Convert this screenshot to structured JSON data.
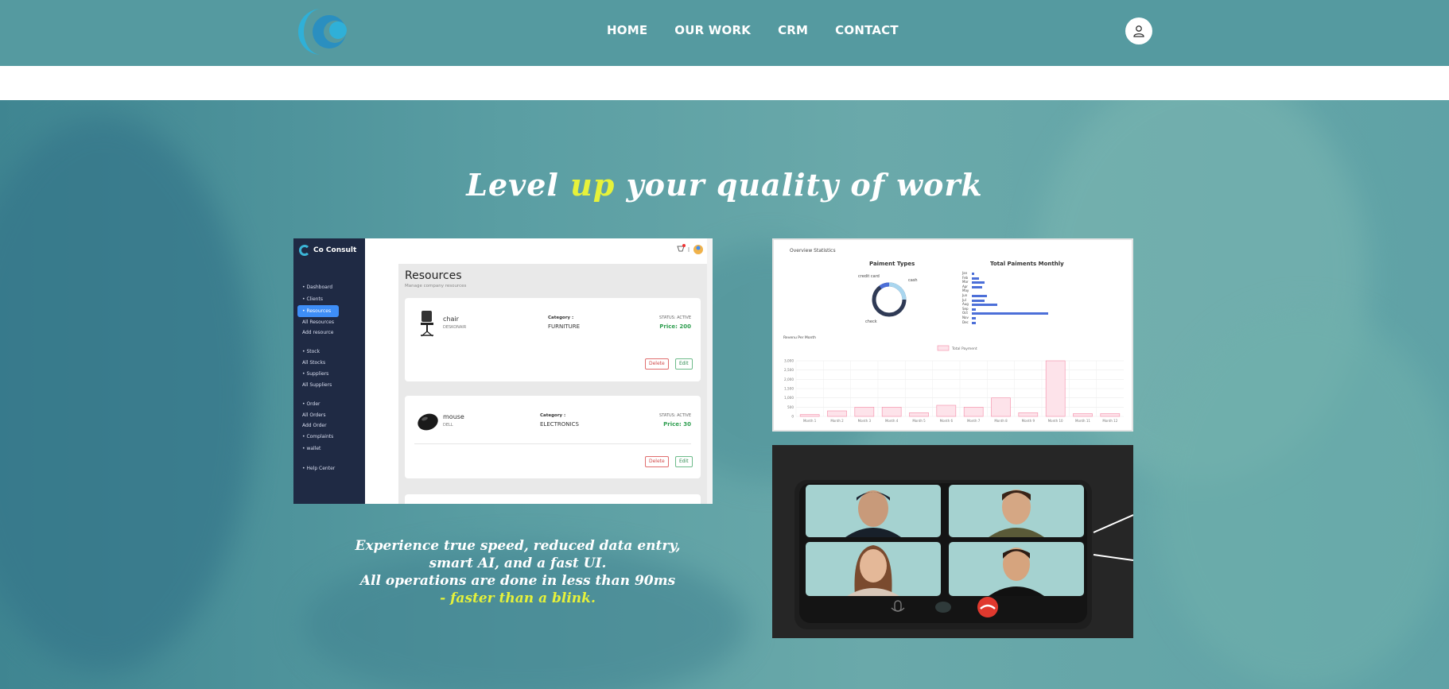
{
  "colors": {
    "navbar": "#559aa0",
    "accent_yellow": "#e6f23a",
    "brand_blue": "#3bb4d6"
  },
  "nav": {
    "logo_icon": "company-logo",
    "links": [
      "HOME",
      "OUR WORK",
      "CRM",
      "CONTACT"
    ],
    "user_icon": "user-icon"
  },
  "hero": {
    "headline_pre": "Level ",
    "headline_highlight": "up",
    "headline_post": " your quality of work",
    "caption_lines": [
      "Experience true speed, reduced data entry,",
      "smart AI, and a fast UI.",
      "All operations are done in less than 90ms"
    ],
    "caption_highlight": "- faster than a blink."
  },
  "resources_preview": {
    "brand": "Co Consult",
    "menu": [
      {
        "label": "Dashboard",
        "type": "main"
      },
      {
        "label": "Clients",
        "type": "main"
      },
      {
        "label": "Resources",
        "type": "active"
      },
      {
        "label": "All Resources",
        "type": "sub"
      },
      {
        "label": "Add resource",
        "type": "sub"
      },
      {
        "label": "Stock",
        "type": "main",
        "gap": true
      },
      {
        "label": "All Stocks",
        "type": "sub"
      },
      {
        "label": "Suppliers",
        "type": "main"
      },
      {
        "label": "All Suppliers",
        "type": "sub"
      },
      {
        "label": "Order",
        "type": "main",
        "gap": true
      },
      {
        "label": "All Orders",
        "type": "sub"
      },
      {
        "label": "Add Order",
        "type": "sub"
      },
      {
        "label": "Complaints",
        "type": "main"
      },
      {
        "label": "wallet",
        "type": "main"
      },
      {
        "label": "Help Center",
        "type": "main",
        "gap": true
      }
    ],
    "title": "Resources",
    "subtitle": "Manage company resources",
    "items": [
      {
        "name": "chair",
        "brand": "DESKONAIR",
        "category_label": "Category :",
        "category": "FURNITURE",
        "status": "STATUS: ACTIVE",
        "price": "Price: 200",
        "icon": "chair-icon"
      },
      {
        "name": "mouse",
        "brand": "DELL",
        "category_label": "Category :",
        "category": "ELECTRONICS",
        "status": "STATUS: ACTIVE",
        "price": "Price: 30",
        "icon": "mouse-icon"
      }
    ],
    "delete_label": "Delete",
    "edit_label": "Edit"
  },
  "stats_preview": {
    "header": "Overview Statistics",
    "donut_title": "Paiment Types",
    "donut_labels": [
      "credit card",
      "cash",
      "check"
    ],
    "bar_title": "Total Paiments Monthly",
    "month_labels": [
      "Jan",
      "Feb",
      "Mar",
      "Apr",
      "May",
      "Jun",
      "Jul",
      "Aug",
      "Sep",
      "Oct",
      "Nov",
      "Dec"
    ],
    "monthly_values": [
      3,
      8,
      15,
      12,
      0,
      18,
      15,
      30,
      5,
      90,
      5,
      5
    ],
    "revenue_title": "Revenu Per Month",
    "revenue_legend": "Total Payment",
    "revenue_yticks": [
      "3,000",
      "2,500",
      "2,000",
      "1,500",
      "1,000",
      "500",
      "0"
    ],
    "revenue_months": [
      "Month 1",
      "Month 2",
      "Month 3",
      "Month 4",
      "Month 5",
      "Month 6",
      "Month 7",
      "Month 8",
      "Month 9",
      "Month 10",
      "Month 11",
      "Month 12"
    ],
    "revenue_values": [
      100,
      300,
      500,
      500,
      200,
      600,
      500,
      1000,
      200,
      3000,
      150,
      150
    ]
  },
  "video_preview": {
    "participants": [
      "participant-1",
      "participant-2",
      "participant-3",
      "participant-4"
    ],
    "controls": [
      "mic-icon",
      "camera-icon",
      "hangup-icon"
    ]
  }
}
